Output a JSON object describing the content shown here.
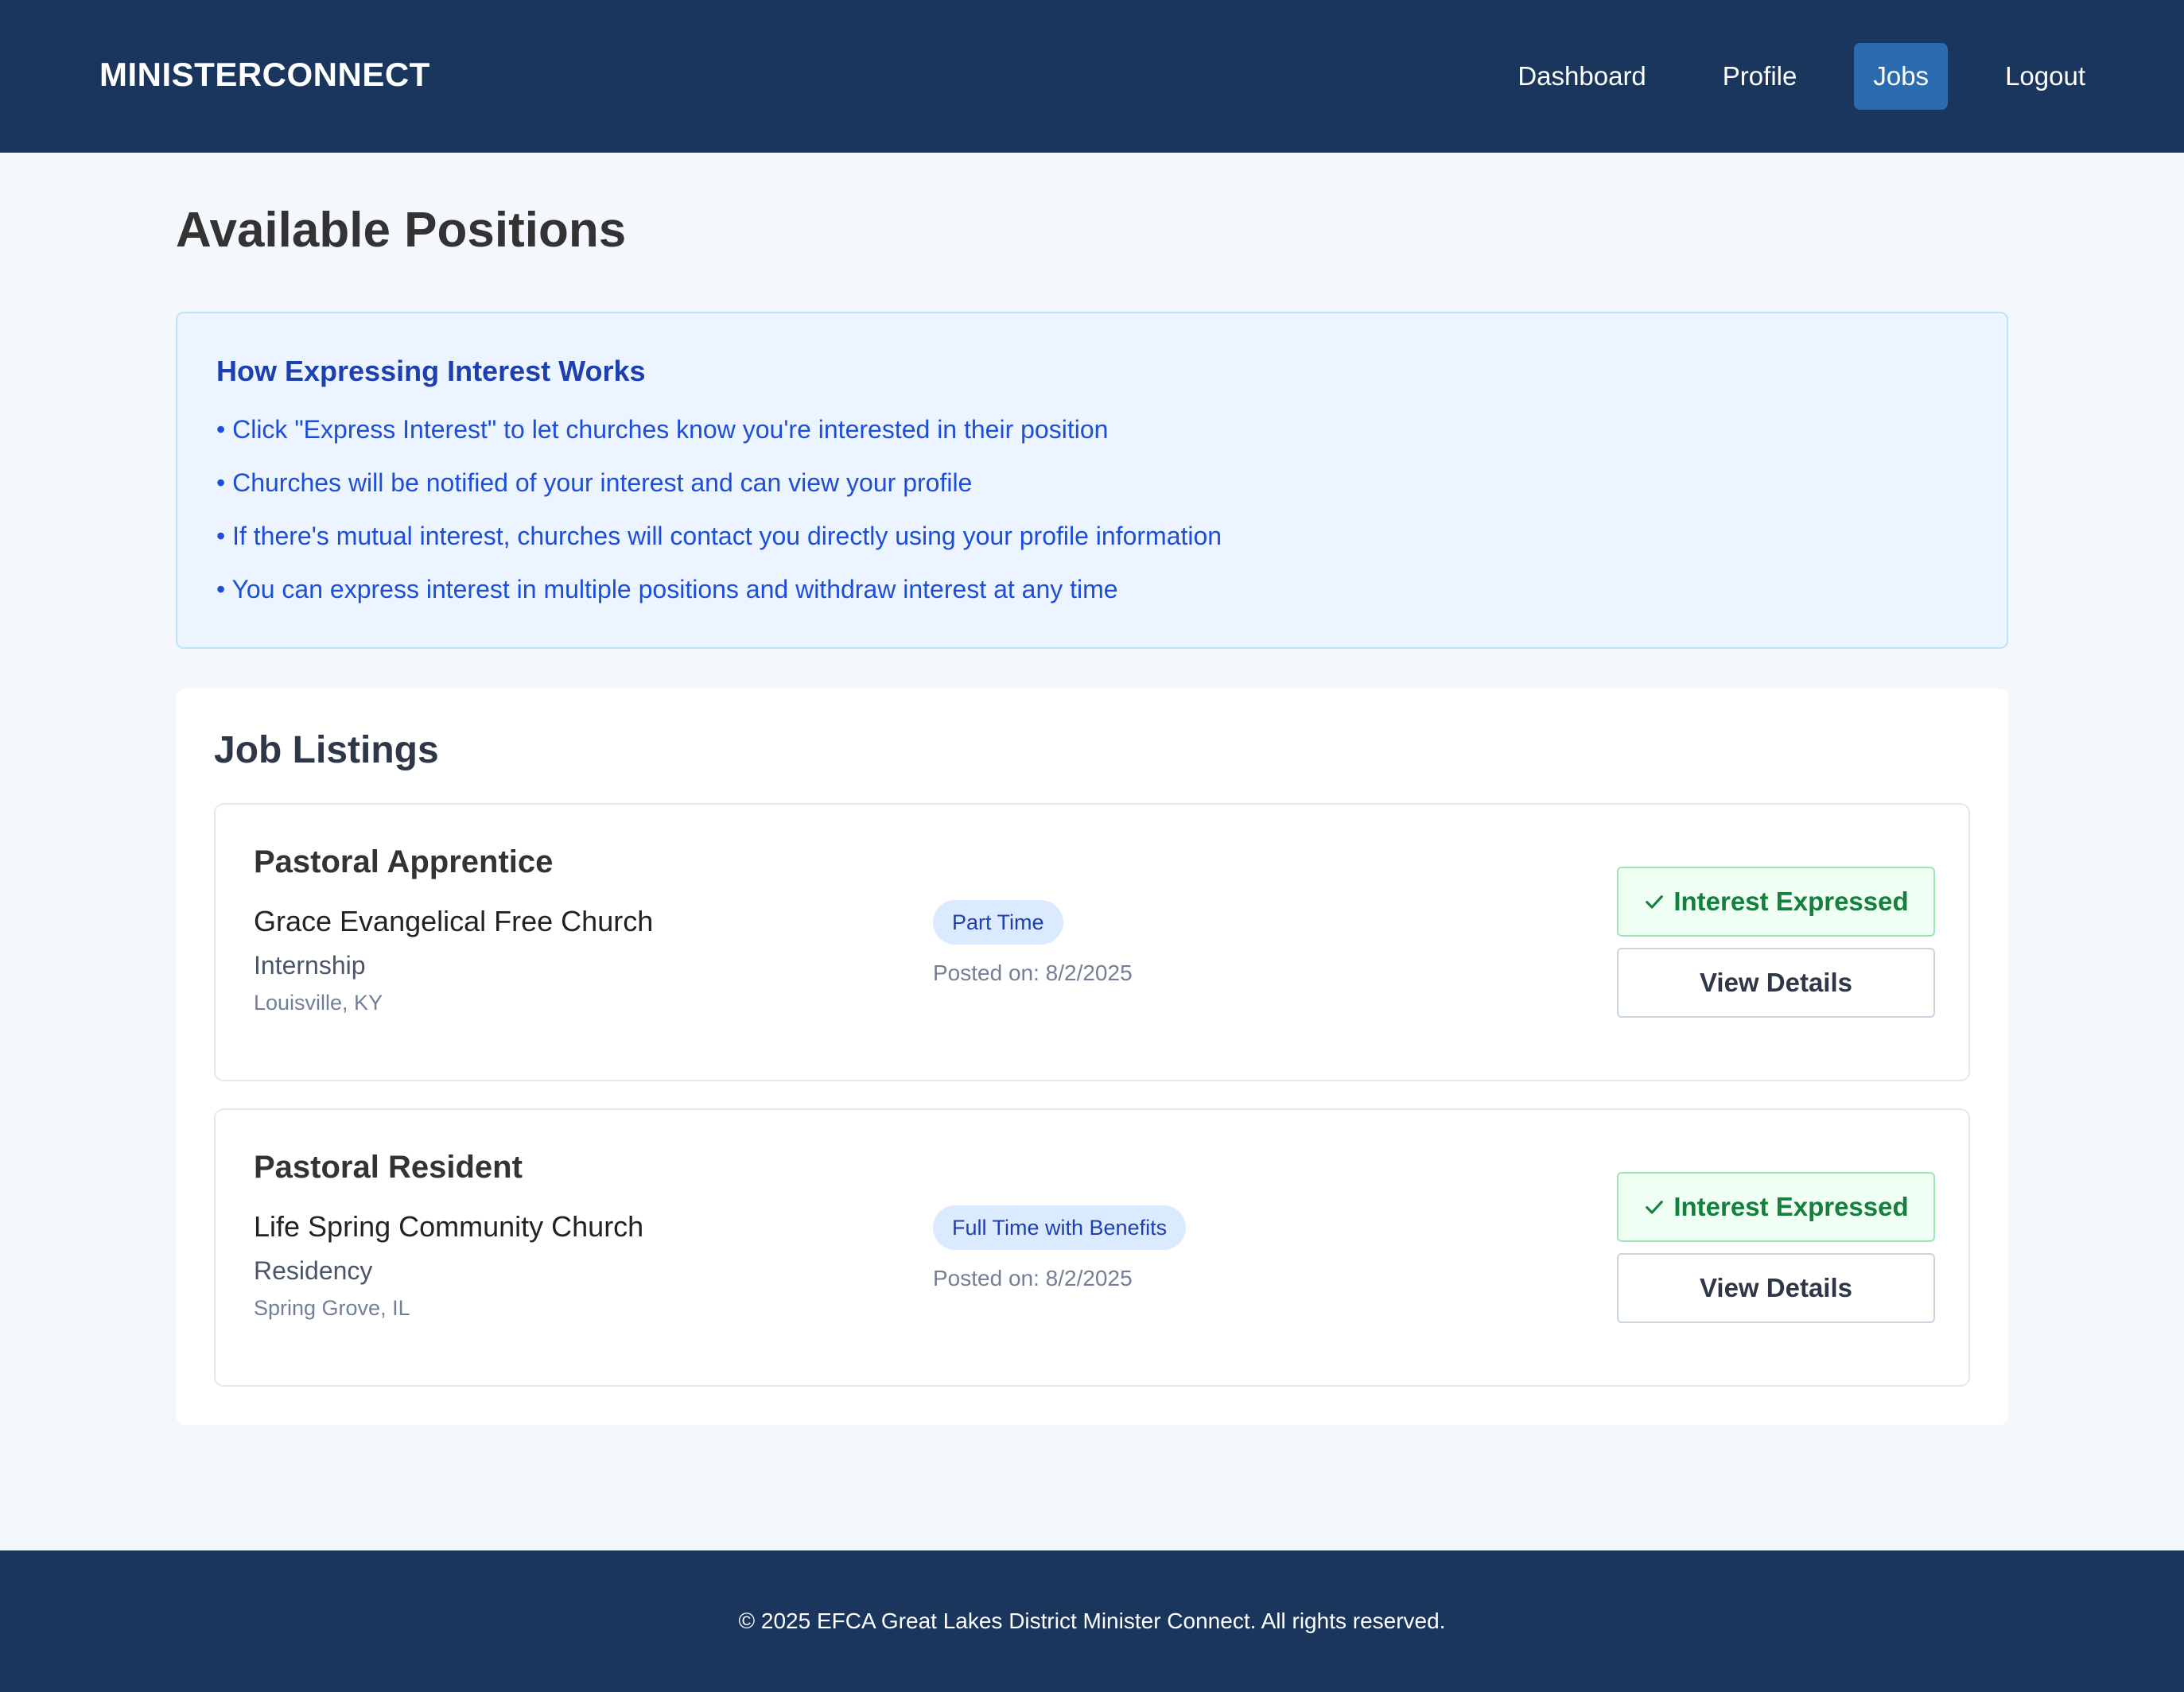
{
  "header": {
    "brand": "MINISTERCONNECT",
    "nav": [
      {
        "label": "Dashboard"
      },
      {
        "label": "Profile"
      },
      {
        "label": "Jobs"
      },
      {
        "label": "Logout"
      }
    ]
  },
  "page": {
    "title": "Available Positions"
  },
  "info": {
    "title": "How Expressing Interest Works",
    "items": [
      "• Click \"Express Interest\" to let churches know you're interested in their position",
      "• Churches will be notified of your interest and can view your profile",
      "• If there's mutual interest, churches will contact you directly using your profile information",
      "• You can express interest in multiple positions and withdraw interest at any time"
    ]
  },
  "listings": {
    "title": "Job Listings",
    "jobs": [
      {
        "title": "Pastoral Apprentice",
        "church": "Grace Evangelical Free Church",
        "type": "Internship",
        "location": "Louisville, KY",
        "badge": "Part Time",
        "posted": "Posted on: 8/2/2025",
        "interest_label": "Interest Expressed",
        "details_label": "View Details"
      },
      {
        "title": "Pastoral Resident",
        "church": "Life Spring Community Church",
        "type": "Residency",
        "location": "Spring Grove, IL",
        "badge": "Full Time with Benefits",
        "posted": "Posted on: 8/2/2025",
        "interest_label": "Interest Expressed",
        "details_label": "View Details"
      }
    ]
  },
  "footer": {
    "text": "© 2025 EFCA Great Lakes District Minister Connect. All rights reserved."
  },
  "colors": {
    "header_bg": "#1b365d",
    "active_nav": "#2b6cb0",
    "info_text": "#1d4ed8",
    "interest_green": "#15803d"
  },
  "icons": {
    "interest": "check-icon"
  }
}
